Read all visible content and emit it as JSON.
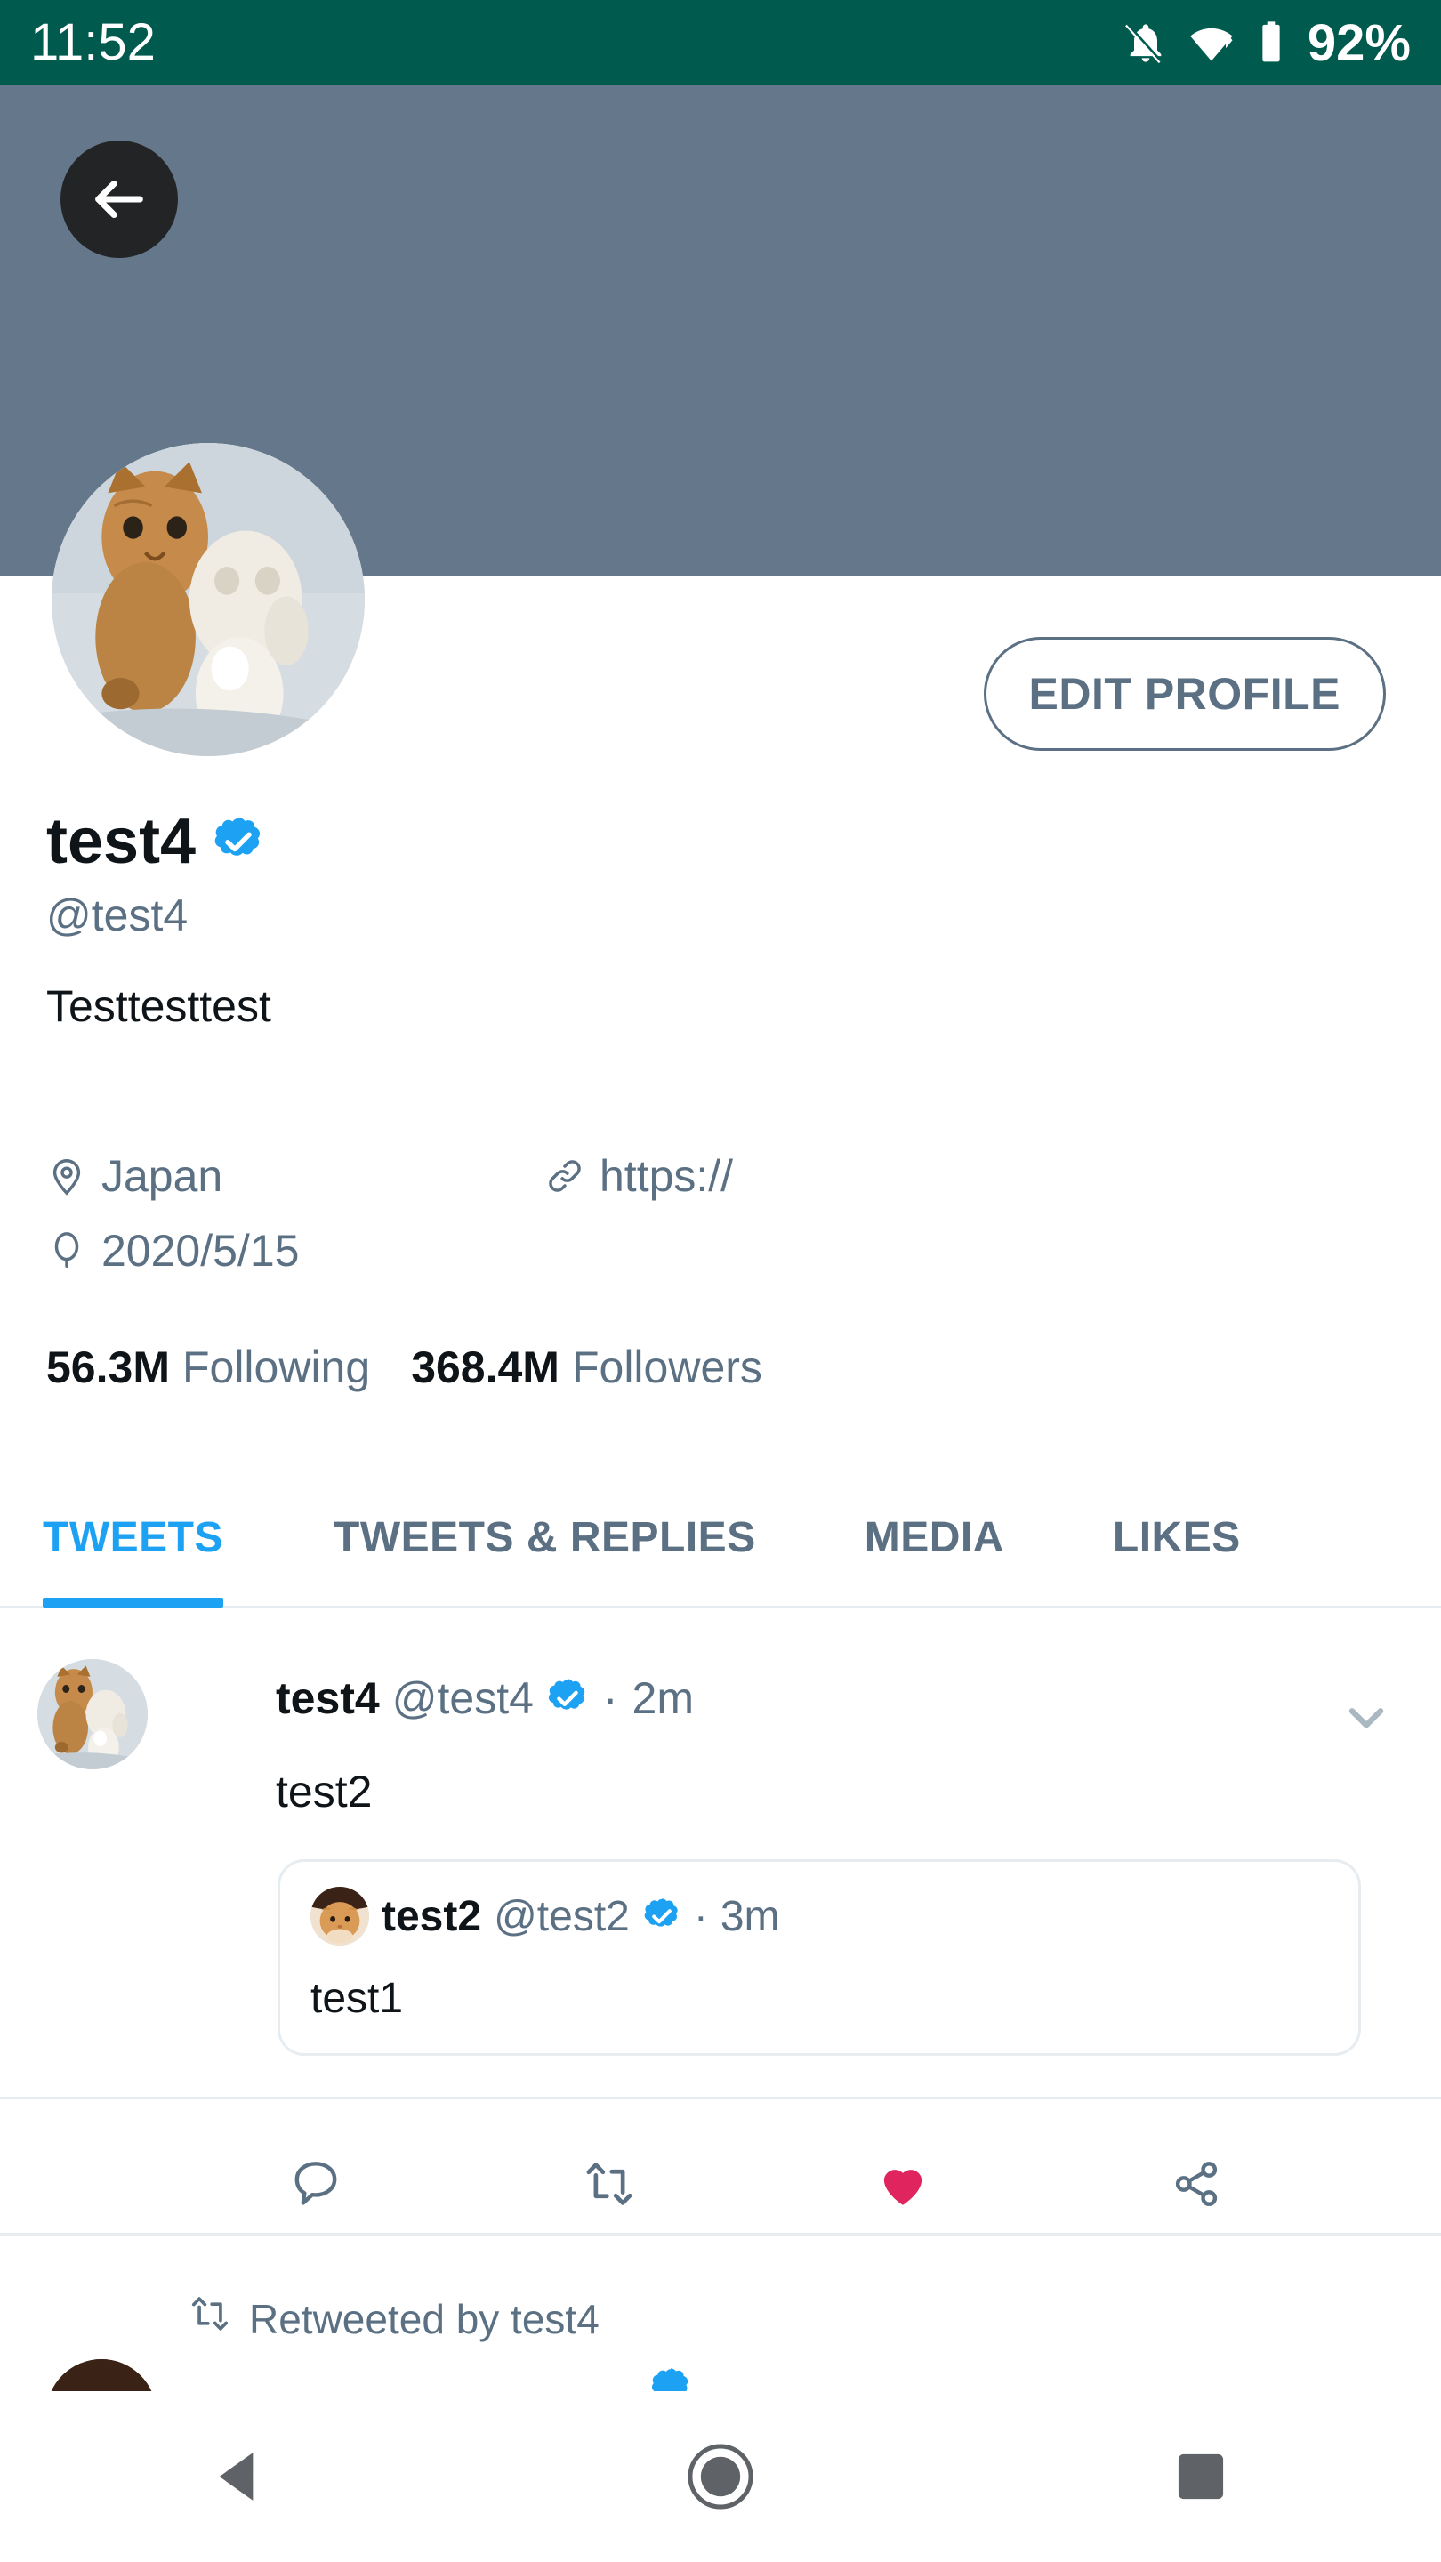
{
  "status_bar": {
    "time": "11:52",
    "battery_percent": "92%",
    "icons": [
      "notifications-off-icon",
      "wifi-icon",
      "battery-icon"
    ],
    "background_color": "#005a4d"
  },
  "banner": {
    "background_color": "#65778a",
    "back_button_icon": "arrow-left-icon"
  },
  "profile": {
    "avatar_alt": "two kittens",
    "edit_profile_label": "EDIT PROFILE",
    "display_name": "test4",
    "verified": true,
    "handle": "@test4",
    "bio": "Testtesttest",
    "location": "Japan",
    "location_icon": "location-pin-icon",
    "website": "https://",
    "website_icon": "link-icon",
    "joined": "2020/5/15",
    "joined_icon": "balloon-icon",
    "following_count": "56.3M",
    "following_label": "Following",
    "followers_count": "368.4M",
    "followers_label": "Followers",
    "accent_color": "#1da1f2",
    "muted_color": "#5b7083"
  },
  "tabs": [
    {
      "label": "TWEETS",
      "active": true
    },
    {
      "label": "TWEETS & REPLIES",
      "active": false
    },
    {
      "label": "MEDIA",
      "active": false
    },
    {
      "label": "LIKES",
      "active": false
    }
  ],
  "timeline": {
    "tweet": {
      "author_name": "test4",
      "author_handle": "@test4",
      "verified": true,
      "separator": "·",
      "timestamp": "2m",
      "text": "test2",
      "caret_icon": "chevron-down-icon",
      "quoted": {
        "author_name": "test2",
        "author_handle": "@test2",
        "verified": true,
        "separator": "·",
        "timestamp": "3m",
        "text": "test1",
        "avatar_alt": "orange tabby cat"
      },
      "actions": [
        {
          "name": "reply-button",
          "icon": "speech-bubble-icon",
          "active": false
        },
        {
          "name": "retweet-button",
          "icon": "retweet-icon",
          "active": false
        },
        {
          "name": "like-button",
          "icon": "heart-icon",
          "active": true,
          "color": "#e0245e"
        },
        {
          "name": "share-button",
          "icon": "share-icon",
          "active": false
        }
      ]
    },
    "next_tweet": {
      "retweet_label": "Retweeted by test4",
      "retweet_icon": "retweet-icon"
    }
  },
  "nav_bar": {
    "back_label": "back-triangle",
    "home_label": "home-circle",
    "recents_label": "recents-square"
  }
}
